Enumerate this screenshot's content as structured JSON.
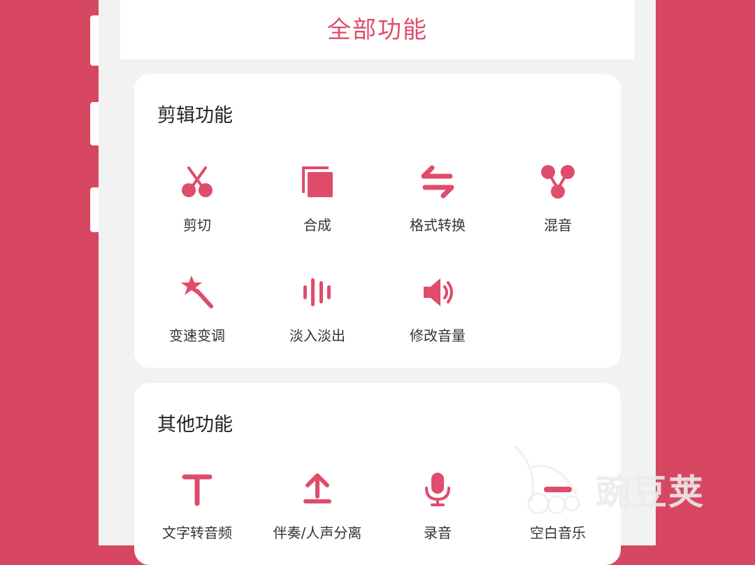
{
  "header": {
    "title": "全部功能"
  },
  "edit_section": {
    "title": "剪辑功能",
    "items": [
      {
        "label": "剪切",
        "icon": "scissors-icon"
      },
      {
        "label": "合成",
        "icon": "merge-icon"
      },
      {
        "label": "格式转换",
        "icon": "convert-icon"
      },
      {
        "label": "混音",
        "icon": "mix-icon"
      },
      {
        "label": "变速变调",
        "icon": "magic-wand-icon"
      },
      {
        "label": "淡入淡出",
        "icon": "waveform-icon"
      },
      {
        "label": "修改音量",
        "icon": "volume-icon"
      }
    ]
  },
  "other_section": {
    "title": "其他功能",
    "items": [
      {
        "label": "文字转音频",
        "icon": "text-icon"
      },
      {
        "label": "伴奏/人声分离",
        "icon": "upload-icon"
      },
      {
        "label": "录音",
        "icon": "microphone-icon"
      },
      {
        "label": "空白音乐",
        "icon": "blank-music-icon"
      }
    ]
  },
  "watermark": {
    "text": "豌豆荚"
  },
  "colors": {
    "accent": "#e04c6b",
    "background": "#d74762",
    "panel": "#f2f2f2"
  }
}
